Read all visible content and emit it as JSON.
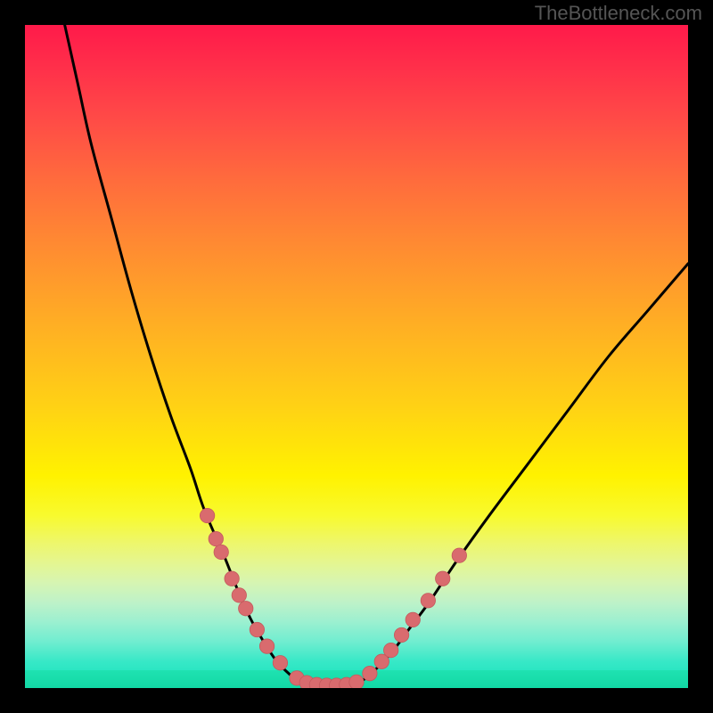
{
  "watermark": "TheBottleneck.com",
  "colors": {
    "curve": "#000000",
    "dot_fill": "#d96b6e",
    "dot_stroke": "#c45a5d",
    "background_black": "#000000"
  },
  "chart_data": {
    "type": "line",
    "title": "",
    "xlabel": "",
    "ylabel": "",
    "xlim": [
      0,
      100
    ],
    "ylim": [
      0,
      100
    ],
    "grid": false,
    "series": [
      {
        "name": "left_curve",
        "x": [
          6,
          8,
          10,
          13,
          16,
          19,
          22,
          25,
          27,
          30,
          32,
          34,
          36,
          38,
          40,
          42
        ],
        "y": [
          100,
          91,
          82,
          71,
          60,
          50,
          41,
          33,
          27,
          20,
          15,
          10.5,
          7,
          4,
          2,
          0.5
        ]
      },
      {
        "name": "right_curve",
        "x": [
          50,
          52,
          55,
          58,
          61,
          65,
          70,
          76,
          82,
          88,
          94,
          100
        ],
        "y": [
          0.5,
          2,
          5,
          9,
          13,
          19,
          26,
          34,
          42,
          50,
          57,
          64
        ]
      },
      {
        "name": "bottom_flat",
        "x": [
          42,
          44,
          46,
          48,
          50
        ],
        "y": [
          0.3,
          0.1,
          0.1,
          0.1,
          0.3
        ]
      }
    ],
    "dots": [
      {
        "x": 27.5,
        "y": 26
      },
      {
        "x": 28.8,
        "y": 22.5
      },
      {
        "x": 29.6,
        "y": 20.5
      },
      {
        "x": 31.2,
        "y": 16.5
      },
      {
        "x": 32.3,
        "y": 14
      },
      {
        "x": 33.3,
        "y": 12
      },
      {
        "x": 35.0,
        "y": 8.8
      },
      {
        "x": 36.5,
        "y": 6.3
      },
      {
        "x": 38.5,
        "y": 3.8
      },
      {
        "x": 41.0,
        "y": 1.5
      },
      {
        "x": 42.5,
        "y": 0.8
      },
      {
        "x": 44.0,
        "y": 0.5
      },
      {
        "x": 45.5,
        "y": 0.4
      },
      {
        "x": 47.0,
        "y": 0.4
      },
      {
        "x": 48.5,
        "y": 0.5
      },
      {
        "x": 50.0,
        "y": 0.9
      },
      {
        "x": 52.0,
        "y": 2.2
      },
      {
        "x": 53.8,
        "y": 4.0
      },
      {
        "x": 55.2,
        "y": 5.7
      },
      {
        "x": 56.8,
        "y": 8.0
      },
      {
        "x": 58.5,
        "y": 10.3
      },
      {
        "x": 60.8,
        "y": 13.2
      },
      {
        "x": 63.0,
        "y": 16.5
      },
      {
        "x": 65.5,
        "y": 20.0
      }
    ]
  }
}
